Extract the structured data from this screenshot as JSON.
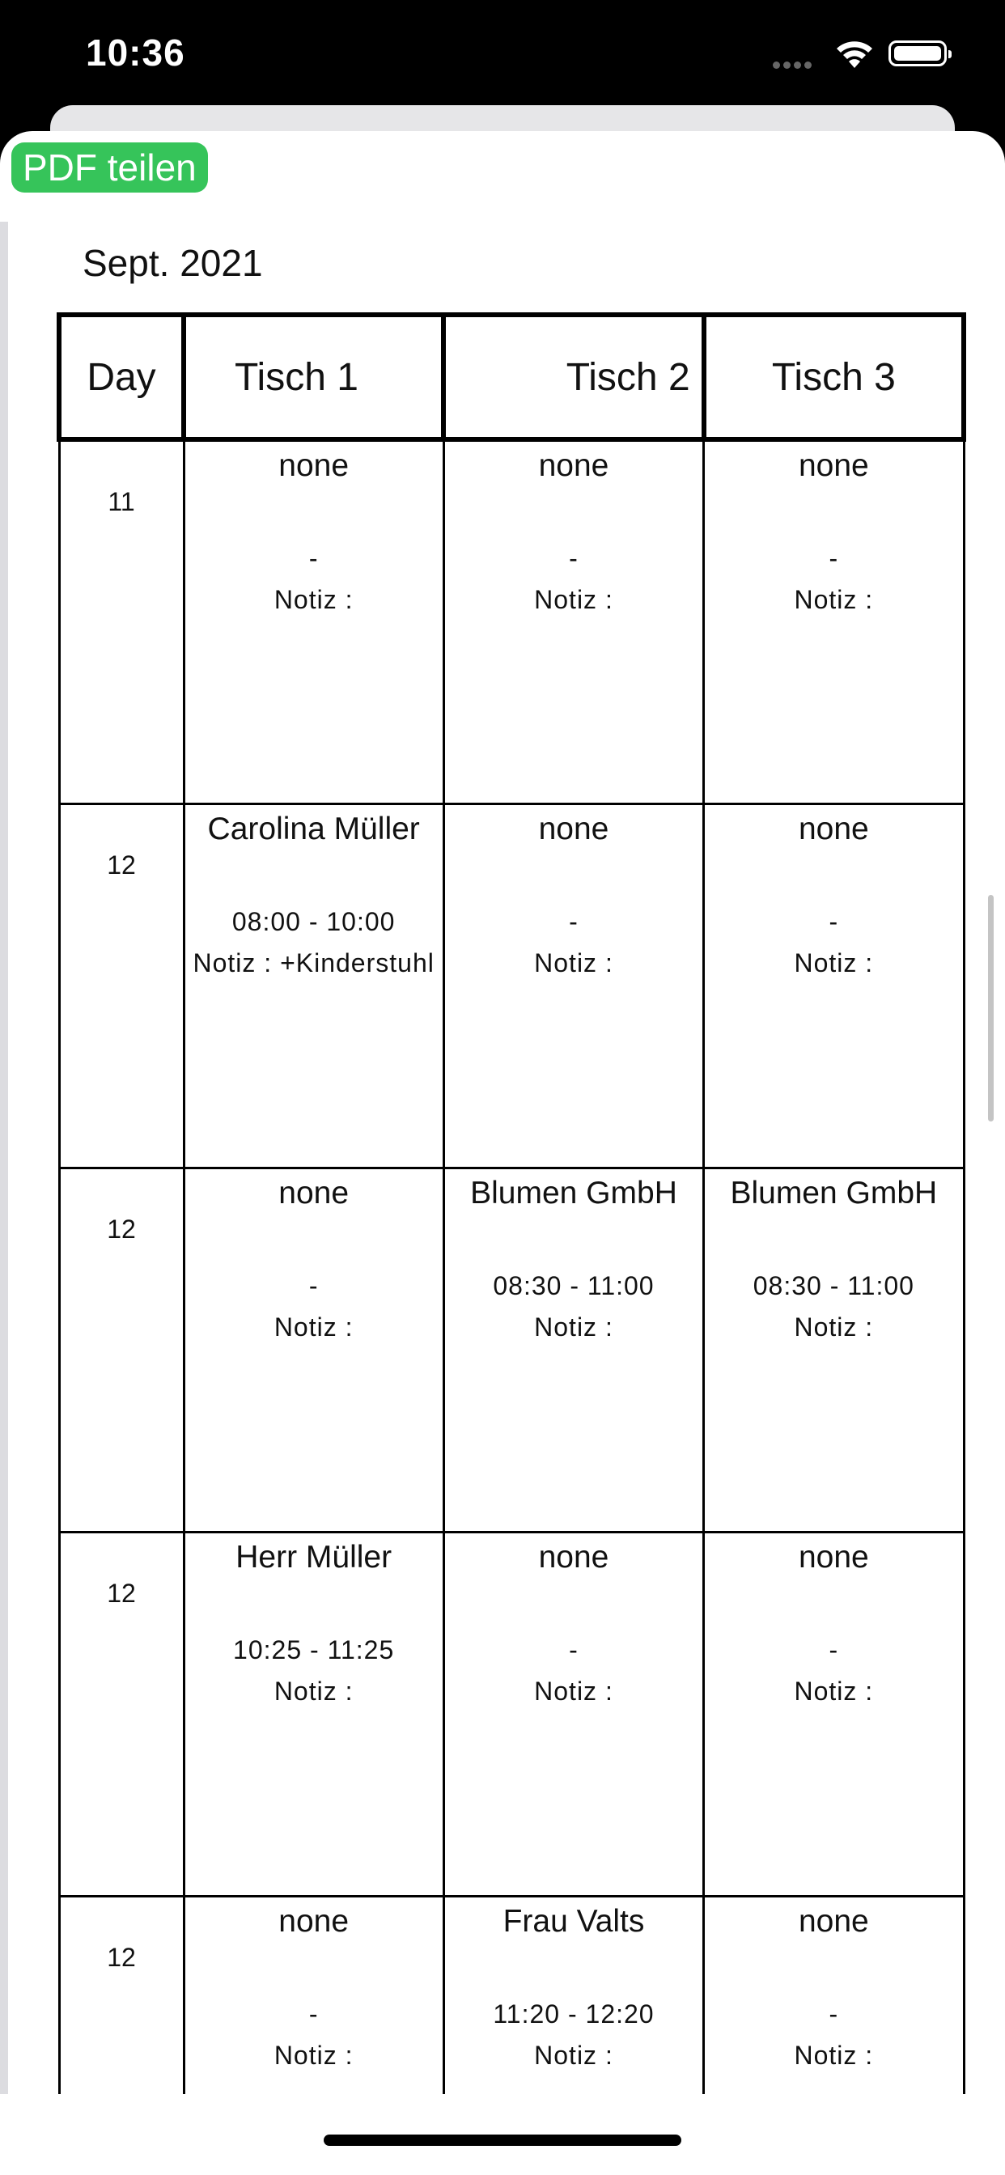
{
  "status_bar": {
    "time": "10:36"
  },
  "toolbar": {
    "share_pdf_label": "PDF teilen"
  },
  "document": {
    "month_label": "Sept. 2021",
    "columns": [
      "Day",
      "Tisch 1",
      "Tisch 2",
      "Tisch 3"
    ],
    "rows": [
      {
        "day": "11",
        "cells": [
          {
            "name": "none",
            "time": "-",
            "note": "Notiz :"
          },
          {
            "name": "none",
            "time": "-",
            "note": "Notiz :"
          },
          {
            "name": "none",
            "time": "-",
            "note": "Notiz :"
          }
        ]
      },
      {
        "day": "12",
        "cells": [
          {
            "name": "Carolina Müller",
            "time": "08:00  - 10:00",
            "note": "Notiz : +Kinderstuhl"
          },
          {
            "name": "none",
            "time": "-",
            "note": "Notiz :"
          },
          {
            "name": "none",
            "time": "-",
            "note": "Notiz :"
          }
        ]
      },
      {
        "day": "12",
        "cells": [
          {
            "name": "none",
            "time": "-",
            "note": "Notiz :"
          },
          {
            "name": "Blumen GmbH",
            "time": "08:30  - 11:00",
            "note": "Notiz :"
          },
          {
            "name": "Blumen GmbH",
            "time": "08:30  - 11:00",
            "note": "Notiz :"
          }
        ]
      },
      {
        "day": "12",
        "cells": [
          {
            "name": "Herr Müller",
            "time": "10:25  - 11:25",
            "note": "Notiz :"
          },
          {
            "name": "none",
            "time": "-",
            "note": "Notiz :"
          },
          {
            "name": "none",
            "time": "-",
            "note": "Notiz :"
          }
        ]
      },
      {
        "day": "12",
        "cells": [
          {
            "name": "none",
            "time": "-",
            "note": "Notiz :"
          },
          {
            "name": "Frau Valts",
            "time": "11:20  - 12:20",
            "note": "Notiz :"
          },
          {
            "name": "none",
            "time": "-",
            "note": "Notiz :"
          }
        ]
      }
    ]
  }
}
